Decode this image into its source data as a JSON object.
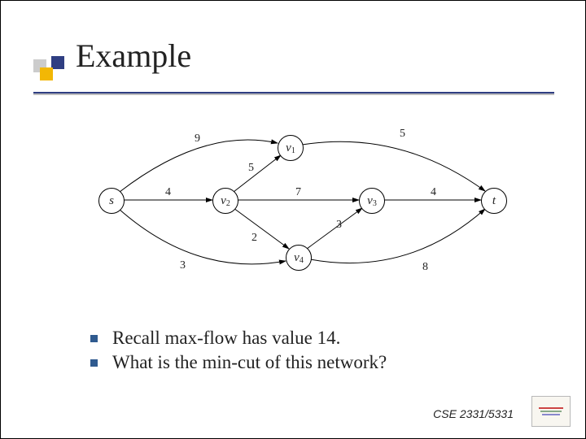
{
  "title": "Example",
  "graph": {
    "nodes": {
      "s": {
        "label": "s"
      },
      "v1": {
        "label": "v",
        "sub": "1"
      },
      "v2": {
        "label": "v",
        "sub": "2"
      },
      "v3": {
        "label": "v",
        "sub": "3"
      },
      "v4": {
        "label": "v",
        "sub": "4"
      },
      "t": {
        "label": "t"
      }
    },
    "edge_labels": {
      "s_v1": "9",
      "s_v2": "4",
      "s_v4": "3",
      "v2_v1": "5",
      "v2_v3": "7",
      "v2_v4": "2",
      "v4_v3": "3",
      "v1_t": "5",
      "v3_t": "4",
      "v4_t": "8"
    }
  },
  "chart_data": {
    "type": "graph",
    "title": "Flow network",
    "directed": true,
    "nodes": [
      "s",
      "v1",
      "v2",
      "v3",
      "v4",
      "t"
    ],
    "edges": [
      {
        "from": "s",
        "to": "v1",
        "capacity": 9
      },
      {
        "from": "s",
        "to": "v2",
        "capacity": 4
      },
      {
        "from": "s",
        "to": "v4",
        "capacity": 3
      },
      {
        "from": "v2",
        "to": "v1",
        "capacity": 5
      },
      {
        "from": "v2",
        "to": "v3",
        "capacity": 7
      },
      {
        "from": "v2",
        "to": "v4",
        "capacity": 2
      },
      {
        "from": "v4",
        "to": "v3",
        "capacity": 3
      },
      {
        "from": "v1",
        "to": "t",
        "capacity": 5
      },
      {
        "from": "v3",
        "to": "t",
        "capacity": 4
      },
      {
        "from": "v4",
        "to": "t",
        "capacity": 8
      }
    ],
    "max_flow_value": 14
  },
  "bullets": [
    "Recall max-flow has value 14.",
    "What is the min-cut of this network?"
  ],
  "footer": "CSE 2331/5331"
}
